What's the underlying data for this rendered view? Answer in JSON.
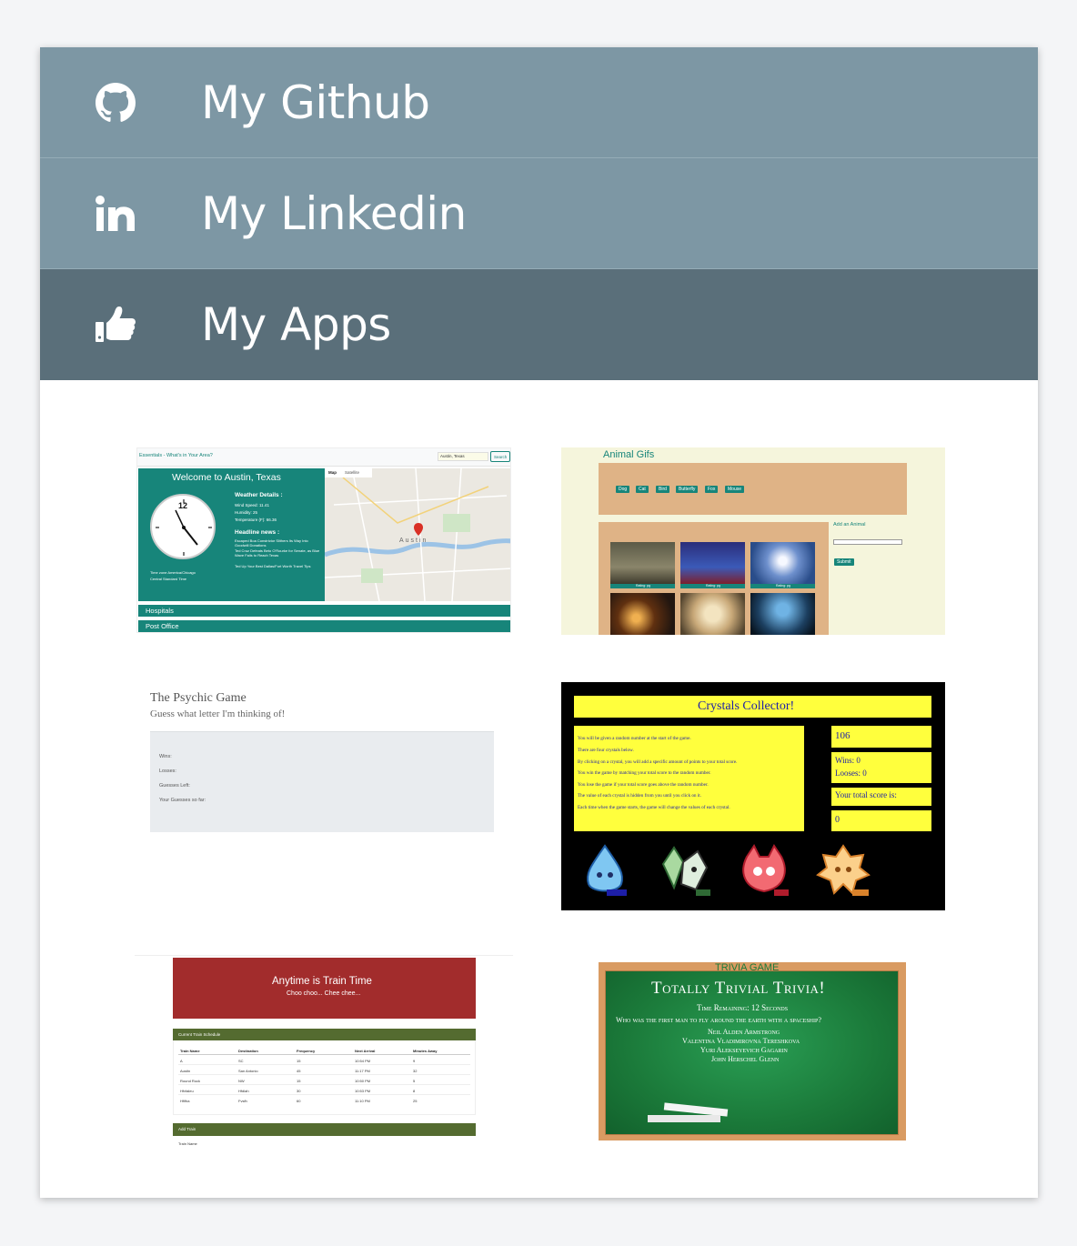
{
  "menu": {
    "github": {
      "label": "My Github",
      "icon": "github-icon"
    },
    "linkedin": {
      "label": "My Linkedin",
      "icon": "linkedin-icon"
    },
    "apps": {
      "label": "My Apps",
      "icon": "thumbs-up-icon"
    }
  },
  "apps": {
    "essentials": {
      "nav_title": "Essentials - What's in Your Area?",
      "search_value": "Austin, Texas",
      "search_button": "Search",
      "welcome": "Welcome to Austin, Texas",
      "clock_number": "12",
      "weather_title": "Weather Details :",
      "wind": "Wind Speed: 11.41",
      "humidity": "Humidity: 25",
      "temperature": "Temperature (F): 66.36",
      "headline_title": "Headline news :",
      "news_1": "Escaped Boa Constrictor Slithers Its Way Into Goodwill Donations",
      "news_2": "Ted Cruz Defeats Beto O'Rourke for Senate, as Blue Wave Fails to Reach Texas",
      "news_3": "Ted Up Your Best Dallas/Fort Worth Travel Tips",
      "timezone": "Time zone America/Chicago",
      "timezone_2": "Central Standard Time",
      "map_tab": "Map",
      "satellite_tab": "Satellite",
      "map_city": "Austin",
      "row_1": "Hospitals",
      "row_2": "Post Office"
    },
    "gifs": {
      "title": "Animal Gifs",
      "buttons": [
        "Dog",
        "Cat",
        "Bird",
        "Butterfly",
        "Fox",
        "Mouse"
      ],
      "add_label": "Add an Animal",
      "submit": "Submit",
      "rating": "Rating: pg"
    },
    "psychic": {
      "title": "The Psychic Game",
      "subtitle": "Guess what letter I'm thinking of!",
      "wins": "Wins:",
      "losses": "Losses:",
      "guesses_left": "Guesses Left:",
      "guesses_so_far": "Your Guesses so far:"
    },
    "crystals": {
      "title": "Crystals Collector!",
      "rules": [
        "You will be given a random number at the start of the game.",
        "There are four crystals below.",
        "By clicking on a crystal, you will add a specific amount of points to your total score.",
        "You win the game by matching your total score to the random number.",
        "You lose the game if your total score goes above the random number.",
        "The value of each crystal is hidden from you until you click on it.",
        "Each time when the game starts, the game will change the values of each crystal."
      ],
      "random_number": "106",
      "wins": "Wins: 0",
      "losses": "Looses: 0",
      "total_label": "Your total score is:",
      "total_value": "0"
    },
    "train": {
      "title": "Anytime is Train Time",
      "subtitle": "Choo choo... Chee chee...",
      "schedule_title": "Current Train Schedule",
      "headers": [
        "Train Name",
        "Destination",
        "Frequency",
        "Next Arrival",
        "Minutes Away"
      ],
      "rows": [
        [
          "A",
          "SC",
          "15",
          "10:54 PM",
          "9"
        ],
        [
          "Austin",
          "San Antonio",
          "45",
          "11:17 PM",
          "32"
        ],
        [
          "Round Rock",
          "NW",
          "15",
          "10:50 PM",
          "5"
        ],
        [
          "Hfvfaleu",
          "Hfdlah",
          "30",
          "10:53 PM",
          "8"
        ],
        [
          "Hfifha",
          "Fvsfh",
          "60",
          "11:10 PM",
          "25"
        ]
      ],
      "add_title": "Add Train",
      "train_name_label": "Train Name"
    },
    "trivia": {
      "banner": "TRIVIA GAME",
      "title": "Totally Trivial Trivia!",
      "time_remaining": "Time Remaining: 12 Seconds",
      "question": "Who was the first man to fly around the earth with a spaceship?",
      "answers": [
        "Neil Alden Armstrong",
        "Valentina Vladimirovna Tereshkova",
        "Yuri Alekseyevich Gagarin",
        "John Herschel Glenn"
      ]
    }
  }
}
